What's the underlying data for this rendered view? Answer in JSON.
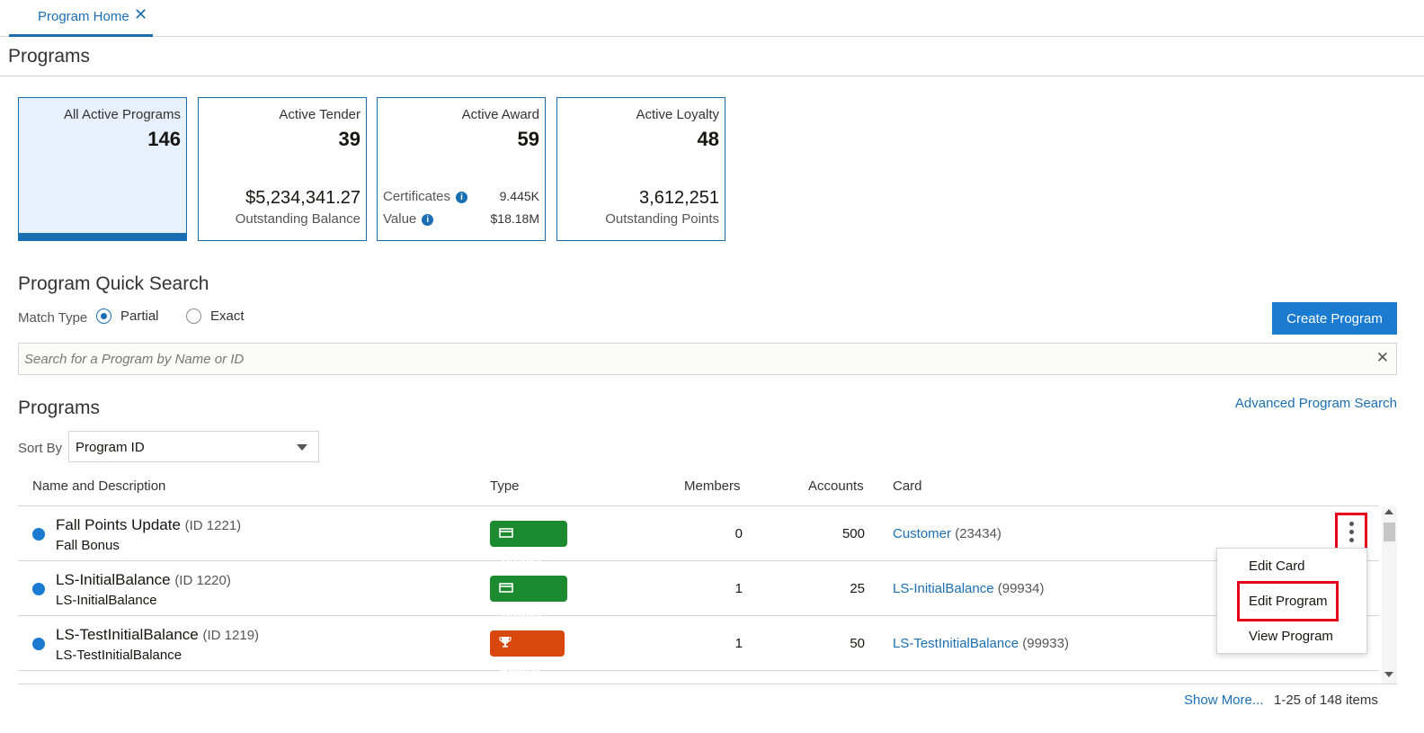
{
  "tabs": [
    {
      "label": "Program Home"
    }
  ],
  "page_title": "Programs",
  "tiles": [
    {
      "label": "All Active Programs",
      "count": "146"
    },
    {
      "label": "Active Tender",
      "count": "39",
      "amount": "$5,234,341.27",
      "amount_label": "Outstanding Balance"
    },
    {
      "label": "Active Award",
      "count": "59",
      "rows": [
        {
          "label": "Certificates",
          "value": "9.445K"
        },
        {
          "label": "Value",
          "value": "$18.18M"
        }
      ]
    },
    {
      "label": "Active Loyalty",
      "count": "48",
      "amount": "3,612,251",
      "amount_label": "Outstanding Points"
    }
  ],
  "quick_search": {
    "title": "Program Quick Search",
    "match_type_label": "Match Type",
    "options": [
      "Partial",
      "Exact"
    ],
    "selected": "Partial",
    "placeholder": "Search for a Program by Name or ID",
    "create_button": "Create Program"
  },
  "programs": {
    "title": "Programs",
    "advanced_link": "Advanced Program Search",
    "sort_label": "Sort By",
    "sort_value": "Program ID",
    "columns": [
      "Name and Description",
      "Type",
      "Members",
      "Accounts",
      "Card"
    ],
    "rows": [
      {
        "name": "Fall Points Update",
        "id": "(ID 1221)",
        "desc": "Fall Bonus",
        "type": "Tender",
        "members": "0",
        "accounts": "500",
        "card": "Customer",
        "card_id": "(23434)"
      },
      {
        "name": "LS-InitialBalance",
        "id": "(ID 1220)",
        "desc": "LS-InitialBalance",
        "type": "Tender",
        "members": "1",
        "accounts": "25",
        "card": "LS-InitialBalance",
        "card_id": "(99934)"
      },
      {
        "name": "LS-TestInitialBalance",
        "id": "(ID 1219)",
        "desc": "LS-TestInitialBalance",
        "type": "Award",
        "members": "1",
        "accounts": "50",
        "card": "LS-TestInitialBalance",
        "card_id": "(99933)"
      }
    ],
    "row_menu": [
      "Edit Card",
      "Edit Program",
      "View Program"
    ],
    "show_more": "Show More...",
    "count_text": "1-25 of 148 items"
  },
  "icons": {
    "tab_close": "close-icon",
    "search_clear": "clear-icon",
    "tender": "credit-card-icon",
    "award": "trophy-icon",
    "row_actions": "kebab-menu-icon"
  },
  "colors": {
    "accent": "#1a6fb4",
    "button": "#1a7bd0",
    "tender": "#1c8a2e",
    "award": "#d8480d",
    "highlight": "#e6001c"
  }
}
